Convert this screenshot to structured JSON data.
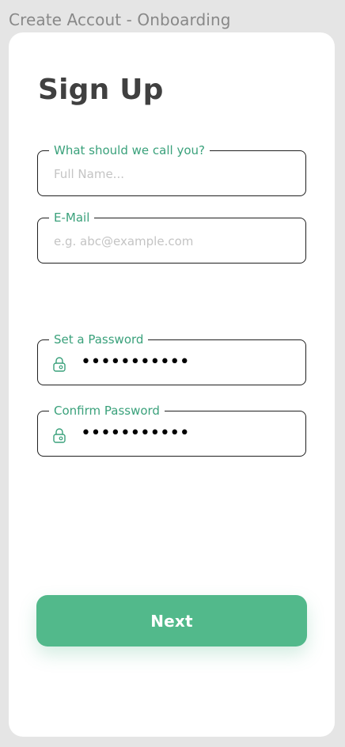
{
  "frame": {
    "title": "Create Accout - Onboarding"
  },
  "form": {
    "heading": "Sign Up",
    "full_name": {
      "label": "What should we call you?",
      "placeholder": "Full Name..."
    },
    "email": {
      "label": "E-Mail",
      "placeholder": "e.g. abc@example.com"
    },
    "password": {
      "label": "Set a Password",
      "icon": "lock-icon",
      "value": "•••••••••••"
    },
    "confirm_password": {
      "label": "Confirm Password",
      "icon": "lock-icon",
      "value": "•••••••••••"
    },
    "next_label": "Next"
  },
  "colors": {
    "accent": "#52b98b",
    "label": "#3aa17b",
    "heading": "#404040",
    "placeholder": "#c4c4c4",
    "background": "#e5e5e5"
  }
}
